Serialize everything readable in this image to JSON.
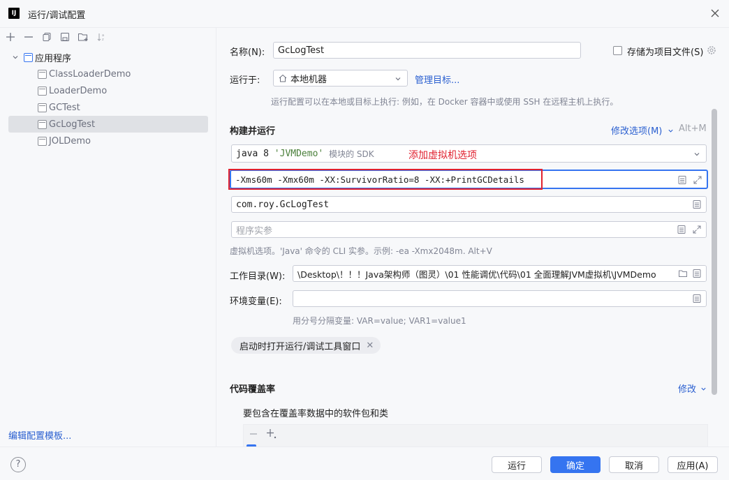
{
  "window": {
    "title": "运行/调试配置"
  },
  "sidebar": {
    "root_label": "应用程序",
    "items": [
      {
        "label": "ClassLoaderDemo"
      },
      {
        "label": "LoaderDemo"
      },
      {
        "label": "GCTest"
      },
      {
        "label": "GcLogTest"
      },
      {
        "label": "JOLDemo"
      }
    ],
    "edit_templates": "编辑配置模板..."
  },
  "form": {
    "name_label": "名称(N):",
    "name_value": "GcLogTest",
    "store_as_file_label": "存储为项目文件(S)",
    "run_on_label": "运行于:",
    "run_on_value": "本地机器",
    "manage_targets": "管理目标...",
    "run_on_hint": "运行配置可以在本地或目标上执行: 例如，在 Docker 容器中或使用 SSH 在远程主机上执行。",
    "build_run_label": "构建并运行",
    "modify_options": "修改选项(M)",
    "modify_shortcut": "Alt+M",
    "sdk_prefix": "java 8",
    "sdk_module": "'JVMDemo'",
    "sdk_suffix": "模块的 SDK",
    "annotation": "添加虚拟机选项",
    "vm_options": "-Xms60m -Xmx60m -XX:SurvivorRatio=8 -XX:+PrintGCDetails",
    "main_class": "com.roy.GcLogTest",
    "program_args_placeholder": "程序实参",
    "vm_hint": "虚拟机选项。'Java' 命令的 CLI 实参。示例: -ea -Xmx2048m. Alt+V",
    "workdir_label": "工作目录(W):",
    "workdir_value": "\\Desktop\\！！！Java架构师（图灵）\\01 性能调优\\代码\\01 全面理解JVM虚拟机\\JVMDemo",
    "env_label": "环境变量(E):",
    "env_value": "",
    "env_hint": "用分号分隔变量: VAR=value; VAR1=value1",
    "chip_label": "启动时打开运行/调试工具窗口",
    "coverage_label": "代码覆盖率",
    "coverage_modify": "修改",
    "coverage_include": "要包含在覆盖率数据中的软件包和类"
  },
  "footer": {
    "help": "?",
    "run": "运行",
    "ok": "确定",
    "cancel": "取消",
    "apply": "应用(A)"
  },
  "colors": {
    "accent": "#3574f0",
    "annotation": "#e0212f",
    "link": "#2a5fd0"
  }
}
